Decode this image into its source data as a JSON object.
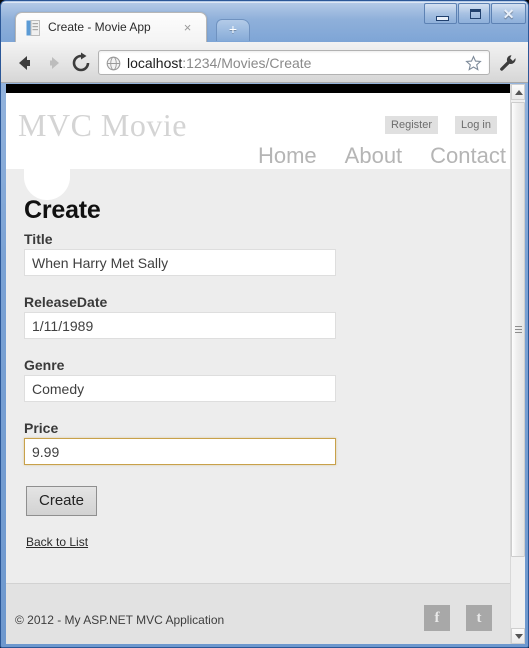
{
  "browser": {
    "tab": {
      "title": "Create - Movie App",
      "favicon_icon": "page-icon",
      "close_icon": "×"
    },
    "new_tab_icon": "+",
    "window_controls": {
      "minimize": "minimize-icon",
      "maximize": "maximize-icon",
      "close": "✕"
    },
    "toolbar": {
      "back_icon": "back-arrow-icon",
      "forward_icon": "forward-arrow-icon",
      "reload_icon": "reload-icon",
      "site_icon": "globe-icon",
      "bookmark_icon": "star-icon",
      "menu_icon": "wrench-icon"
    },
    "omnibox": {
      "host": "localhost",
      "path": ":1234/Movies/Create",
      "full_url": "localhost:1234/Movies/Create"
    }
  },
  "site": {
    "brand": "MVC Movie",
    "account": {
      "register": "Register",
      "login": "Log in"
    },
    "nav": [
      {
        "label": "Home"
      },
      {
        "label": "About"
      },
      {
        "label": "Contact"
      }
    ]
  },
  "form": {
    "heading": "Create",
    "fields": [
      {
        "label": "Title",
        "value": "When Harry Met Sally",
        "focused": false
      },
      {
        "label": "ReleaseDate",
        "value": "1/11/1989",
        "focused": false
      },
      {
        "label": "Genre",
        "value": "Comedy",
        "focused": false
      },
      {
        "label": "Price",
        "value": "9.99",
        "focused": true
      }
    ],
    "submit_label": "Create",
    "back_link": "Back to List"
  },
  "footer": {
    "copyright": "© 2012 - My ASP.NET MVC Application",
    "social": [
      {
        "name": "facebook-icon",
        "glyph": "f"
      },
      {
        "name": "twitter-icon",
        "glyph": "t"
      }
    ]
  },
  "colors": {
    "focus_border": "#c8a14a",
    "page_background": "#ededed",
    "footer_background": "#e2e2e2",
    "brand_text": "#d4d4d4",
    "window_frame": "#2b5797"
  }
}
